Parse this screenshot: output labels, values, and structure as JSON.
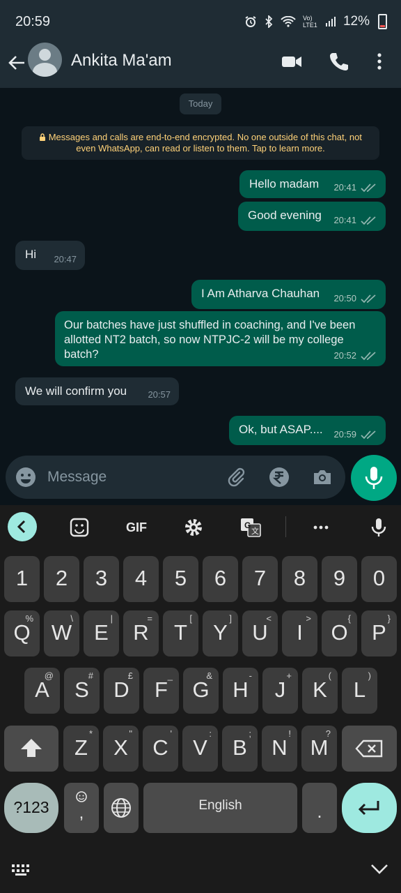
{
  "status_bar": {
    "time": "20:59",
    "network": "Vo) LTE1",
    "battery": "12%"
  },
  "header": {
    "contact_name": "Ankita Ma'am"
  },
  "chat": {
    "date_chip": "Today",
    "encryption_notice_line1": "Messages and calls are end-to-end encrypted. No one outside of this chat, not",
    "encryption_notice_line2": "even WhatsApp, can read or listen to them. Tap to learn more.",
    "messages": [
      {
        "direction": "outgoing",
        "text": "Hello madam",
        "time": "20:41",
        "status": "read"
      },
      {
        "direction": "outgoing",
        "text": "Good evening",
        "time": "20:41",
        "status": "read"
      },
      {
        "direction": "incoming",
        "text": "Hi",
        "time": "20:47"
      },
      {
        "direction": "outgoing",
        "text": "I Am Atharva Chauhan",
        "time": "20:50",
        "status": "read"
      },
      {
        "direction": "outgoing",
        "lines": [
          "Our batches have just shuffled in coaching, and I've been",
          "allotted NT2 batch, so now NTPJC-2 will be my college",
          "batch?"
        ],
        "time": "20:52",
        "status": "read"
      },
      {
        "direction": "incoming",
        "text": "We will confirm you",
        "time": "20:57"
      },
      {
        "direction": "outgoing",
        "text": "Ok, but ASAP....",
        "time": "20:59",
        "status": "read"
      }
    ]
  },
  "composer": {
    "placeholder": "Message"
  },
  "keyboard": {
    "toolbar": {
      "gif_label": "GIF"
    },
    "number_row": [
      "1",
      "2",
      "3",
      "4",
      "5",
      "6",
      "7",
      "8",
      "9",
      "0"
    ],
    "row1": [
      {
        "k": "Q",
        "a": "%"
      },
      {
        "k": "W",
        "a": "\\"
      },
      {
        "k": "E",
        "a": "|"
      },
      {
        "k": "R",
        "a": "="
      },
      {
        "k": "T",
        "a": "["
      },
      {
        "k": "Y",
        "a": "]"
      },
      {
        "k": "U",
        "a": "<"
      },
      {
        "k": "I",
        "a": ">"
      },
      {
        "k": "O",
        "a": "{"
      },
      {
        "k": "P",
        "a": "}"
      }
    ],
    "row2": [
      {
        "k": "A",
        "a": "@"
      },
      {
        "k": "S",
        "a": "#"
      },
      {
        "k": "D",
        "a": "£"
      },
      {
        "k": "F",
        "a": "_"
      },
      {
        "k": "G",
        "a": "&"
      },
      {
        "k": "H",
        "a": "-"
      },
      {
        "k": "J",
        "a": "+"
      },
      {
        "k": "K",
        "a": "("
      },
      {
        "k": "L",
        "a": ")"
      }
    ],
    "row3": [
      {
        "k": "Z",
        "a": "*"
      },
      {
        "k": "X",
        "a": "\""
      },
      {
        "k": "C",
        "a": "'"
      },
      {
        "k": "V",
        "a": ":"
      },
      {
        "k": "B",
        "a": ";"
      },
      {
        "k": "N",
        "a": "!"
      },
      {
        "k": "M",
        "a": "?"
      }
    ],
    "symbols_label": "?123",
    "comma_label": ",",
    "space_label": "English",
    "period_label": "."
  },
  "colors": {
    "outgoing_bubble": "#005c4b",
    "incoming_bubble": "#1f2c34",
    "accent": "#00a884",
    "tick_read": "#53bdeb"
  }
}
